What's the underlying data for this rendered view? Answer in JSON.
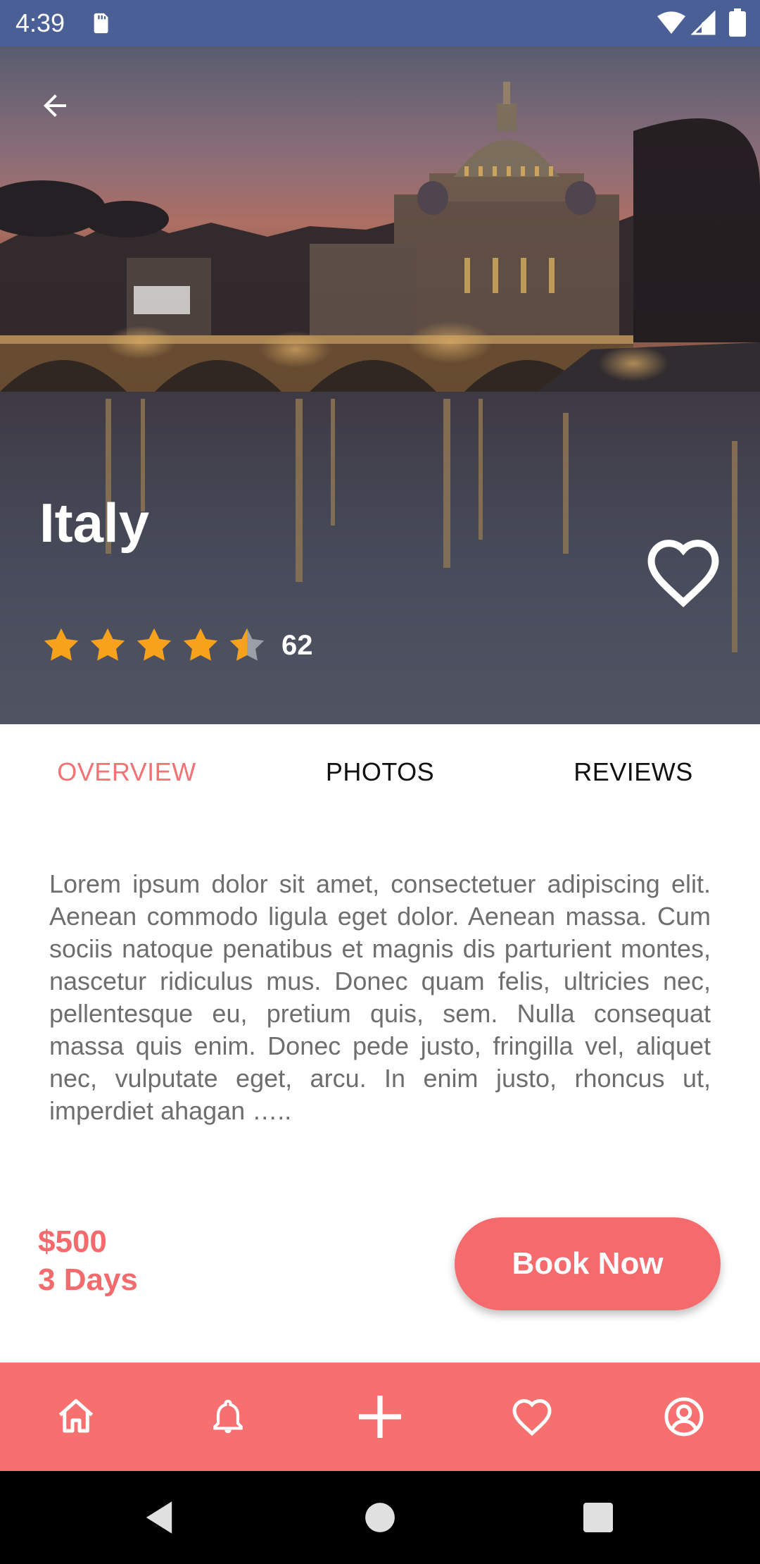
{
  "status_bar": {
    "time": "4:39",
    "icons": [
      "sd-card-icon",
      "wifi-icon",
      "signal-icon",
      "battery-icon"
    ]
  },
  "hero": {
    "image": "rome-night-river-bridge-dome",
    "title": "Italy",
    "rating": 4.5,
    "rating_max": 5,
    "review_count": "62",
    "favorite_icon": "heart-outline-icon",
    "back_icon": "arrow-back-icon"
  },
  "tabs": [
    {
      "label": "OVERVIEW",
      "active": true
    },
    {
      "label": "PHOTOS",
      "active": false
    },
    {
      "label": "REVIEWS",
      "active": false
    }
  ],
  "overview": {
    "text": "Lorem ipsum dolor sit amet, consectetuer adipiscing elit. Aenean commodo ligula eget dolor. Aenean massa. Cum sociis natoque penatibus et magnis dis parturient montes, nascetur ridiculus mus. Donec quam felis, ultricies nec, pellentesque eu, pretium quis, sem. Nulla consequat massa quis enim. Donec pede justo, fringilla vel, aliquet nec, vulputate eget, arcu. In enim justo, rhoncus ut, imperdiet ahagan ….."
  },
  "booking": {
    "price": "$500",
    "duration": "3 Days",
    "button_label": "Book Now"
  },
  "bottom_nav": {
    "items": [
      "home-icon",
      "bell-icon",
      "plus-icon",
      "heart-icon",
      "profile-icon"
    ]
  },
  "system_nav": {
    "items": [
      "back-triangle-icon",
      "home-circle-icon",
      "recents-square-icon"
    ]
  },
  "colors": {
    "accent": "#f46b6e",
    "status_bar": "#4a5f95",
    "star": "#f7a21a",
    "star_empty": "#9aa0a6"
  }
}
